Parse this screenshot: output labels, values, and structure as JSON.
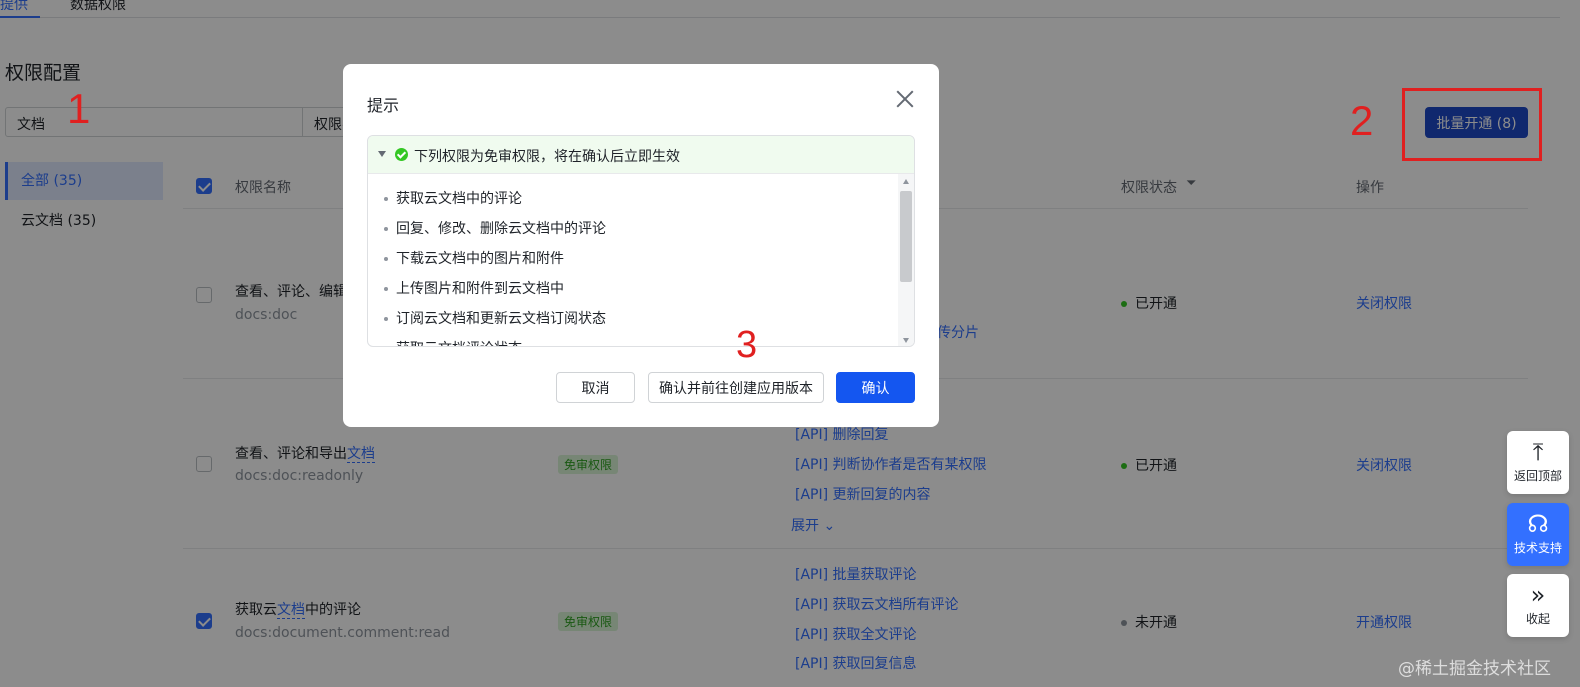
{
  "tabs": [
    {
      "label": "提供"
    },
    {
      "label": "数据权限"
    }
  ],
  "page_title": "权限配置",
  "filter": {
    "scope": "文档",
    "field": "权限名"
  },
  "batch_button": "批量开通 (8)",
  "annotations": [
    "1",
    "2",
    "3"
  ],
  "sidebar": {
    "items": [
      {
        "label": "全部 (35)"
      },
      {
        "label": "云文档 (35)"
      }
    ]
  },
  "table": {
    "headers": {
      "name": "权限名称",
      "status": "权限状态",
      "op": "操作"
    },
    "rows": [
      {
        "name_prefix": "查看、评论、编辑",
        "name_hl": "",
        "name_suffix": "",
        "code": "docs:doc",
        "tag": "",
        "apis": [
          "传分片"
        ],
        "expand": "",
        "status": "已开通",
        "op": "关闭权限",
        "checked": false
      },
      {
        "name_prefix": "查看、评论和导出",
        "name_hl": "文档",
        "name_suffix": "",
        "code": "docs:doc:readonly",
        "tag": "免审权限",
        "apis": [
          "[API] 删除回复",
          "[API] 判断协作者是否有某权限",
          "[API] 更新回复的内容"
        ],
        "expand": "展开",
        "status": "已开通",
        "op": "关闭权限",
        "checked": false
      },
      {
        "name_prefix": "获取云",
        "name_hl": "文档",
        "name_suffix": "中的评论",
        "code": "docs:document.comment:read",
        "tag": "免审权限",
        "apis": [
          "[API] 批量获取评论",
          "[API] 获取云文档所有评论",
          "[API] 获取全文评论",
          "[API] 获取回复信息"
        ],
        "expand": "",
        "status": "未开通",
        "op": "开通权限",
        "checked": true
      }
    ]
  },
  "float": {
    "top": "返回顶部",
    "support": "技术支持",
    "collapse": "收起"
  },
  "watermark": "@稀土掘金技术社区",
  "modal": {
    "title": "提示",
    "notice": "下列权限为免审权限，将在确认后立即生效",
    "items": [
      "获取云文档中的评论",
      "回复、修改、删除云文档中的评论",
      "下载云文档中的图片和附件",
      "上传图片和附件到云文档中",
      "订阅云文档和更新云文档订阅状态",
      "获取云文档评论状态"
    ],
    "cancel": "取消",
    "goto": "确认并前往创建应用版本",
    "confirm": "确认"
  },
  "colors": {
    "accent": "#3370ff",
    "primary_button": "#1456f0",
    "annotation": "#e02020",
    "success": "#34c724"
  }
}
